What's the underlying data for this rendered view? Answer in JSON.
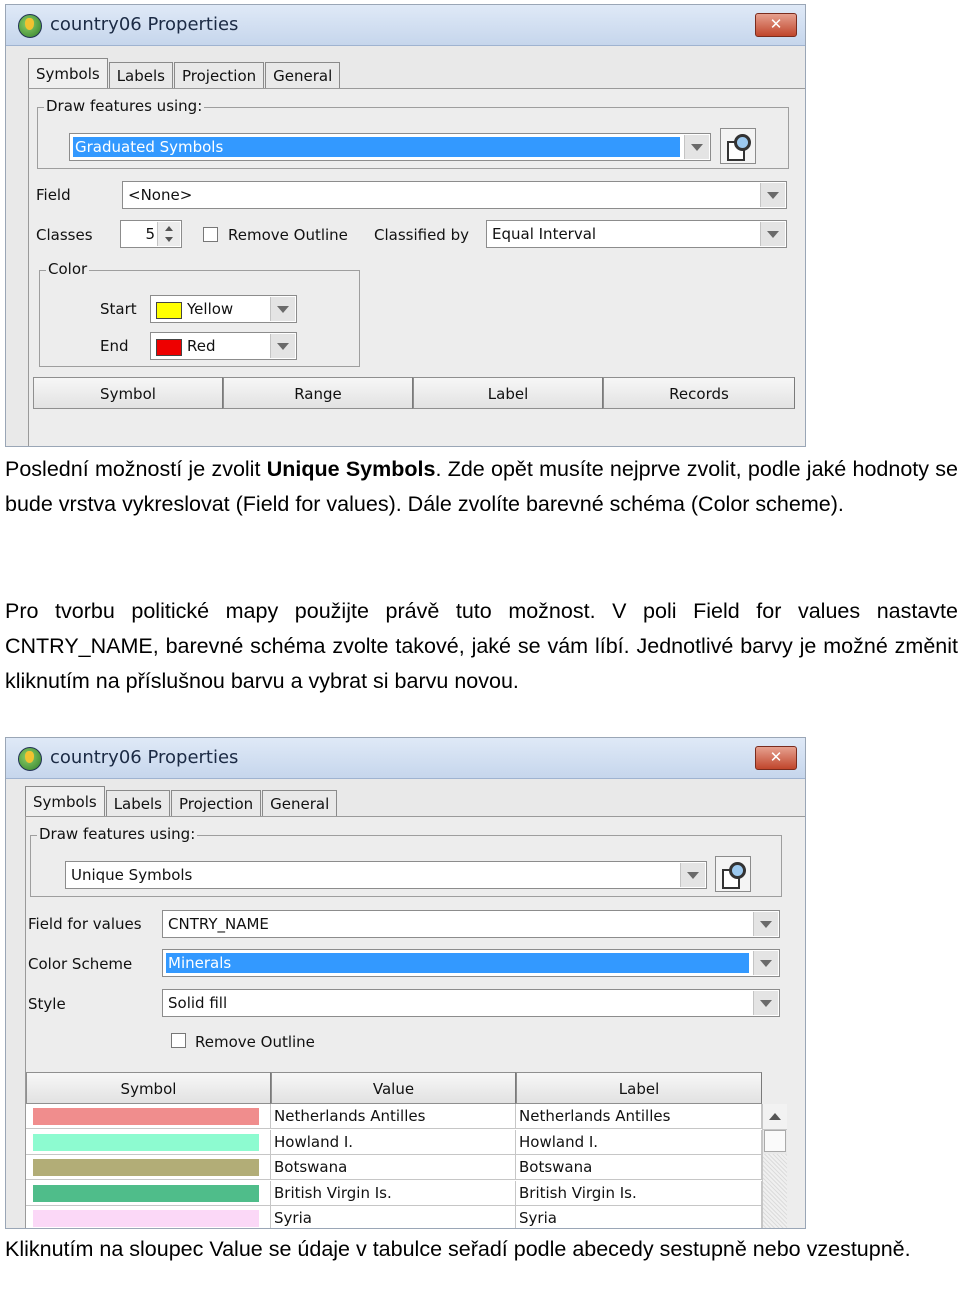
{
  "dialog1": {
    "title": "country06 Properties",
    "close_label": "✕",
    "tabs": [
      "Symbols",
      "Labels",
      "Projection",
      "General"
    ],
    "draw_group_label": "Draw features using:",
    "draw_features_value": "Graduated Symbols",
    "field_label": "Field",
    "field_value": "<None>",
    "classes_label": "Classes",
    "classes_value": "5",
    "remove_outline_label": "Remove Outline",
    "classified_by_label": "Classified by",
    "classified_by_value": "Equal Interval",
    "color_group_label": "Color",
    "start_label": "Start",
    "start_value": "Yellow",
    "start_color": "#ffff00",
    "end_label": "End",
    "end_value": "Red",
    "end_color": "#ee0000",
    "columns": [
      "Symbol",
      "Range",
      "Label",
      "Records"
    ]
  },
  "para1": {
    "prefix": "Poslední možností je zvolit ",
    "bold": "Unique Symbols",
    "suffix": ". Zde opět musíte nejprve zvolit, podle jaké hodnoty se bude vrstva vykreslovat (Field for values). Dále zvolíte barevné schéma (Color scheme)."
  },
  "para2": "Pro tvorbu politické mapy použijte právě tuto možnost. V poli Field for values nastavte CNTRY_NAME, barevné schéma zvolte takové, jaké se vám líbí. Jednotlivé barvy je možné změnit kliknutím na příslušnou barvu a vybrat si barvu novou.",
  "dialog2": {
    "title": "country06 Properties",
    "close_label": "✕",
    "tabs": [
      "Symbols",
      "Labels",
      "Projection",
      "General"
    ],
    "draw_group_label": "Draw features using:",
    "draw_features_value": "Unique Symbols",
    "field_for_values_label": "Field for values",
    "field_for_values_value": "CNTRY_NAME",
    "color_scheme_label": "Color Scheme",
    "color_scheme_value": "Minerals",
    "style_label": "Style",
    "style_value": "Solid fill",
    "remove_outline_label": "Remove Outline",
    "columns": [
      "Symbol",
      "Value",
      "Label"
    ],
    "rows": [
      {
        "color": "#f08d8d",
        "value": "Netherlands Antilles",
        "label": "Netherlands Antilles"
      },
      {
        "color": "#8dfbd0",
        "value": "Howland I.",
        "label": "Howland I."
      },
      {
        "color": "#b2ad77",
        "value": "Botswana",
        "label": "Botswana"
      },
      {
        "color": "#4fbd8a",
        "value": "British Virgin Is.",
        "label": "British Virgin Is."
      },
      {
        "color": "#fbd8f7",
        "value": "Syria",
        "label": "Syria"
      }
    ]
  },
  "para3": "Kliknutím na sloupec Value se údaje v tabulce seřadí podle abecedy sestupně nebo vzestupně."
}
